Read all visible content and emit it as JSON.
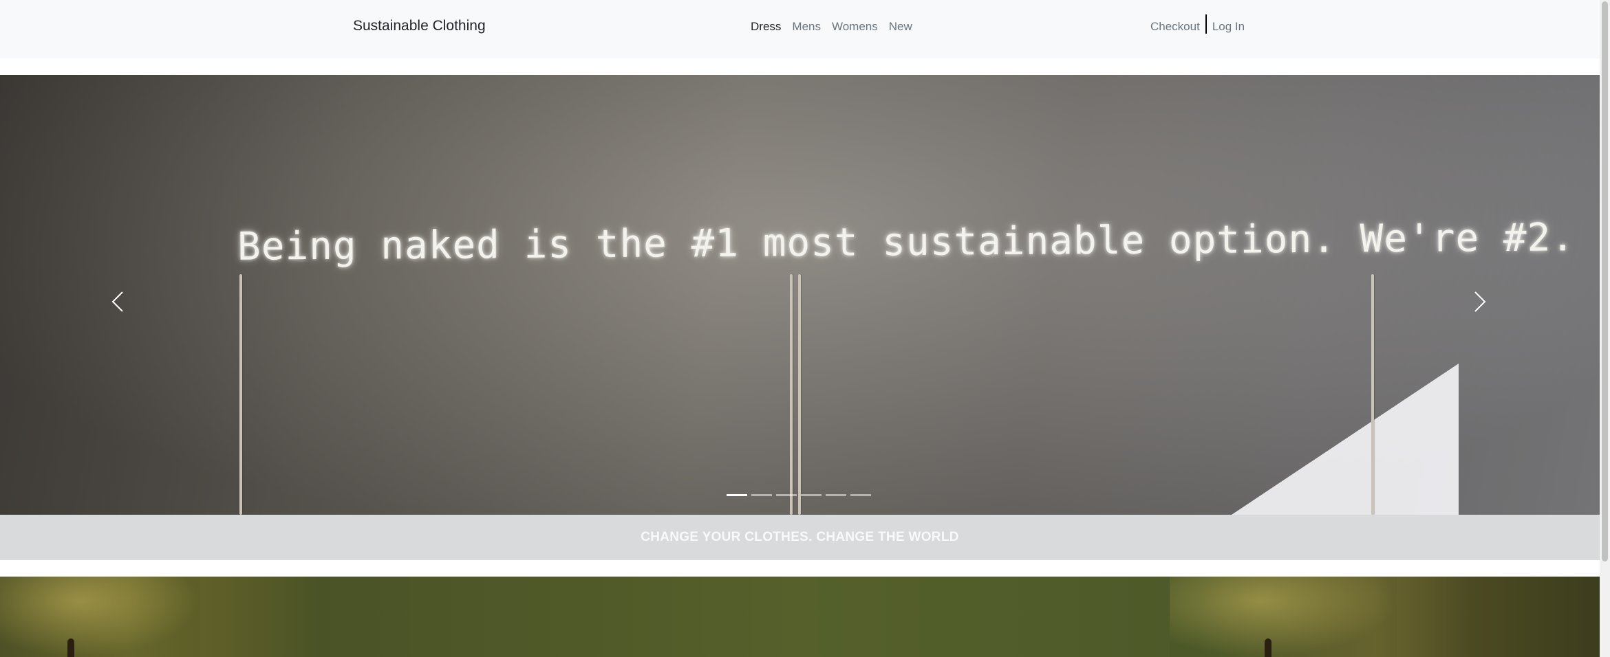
{
  "navbar": {
    "brand": "Sustainable Clothing",
    "links": [
      "Dress",
      "Mens",
      "Womens",
      "New"
    ],
    "active_link": "Dress",
    "right_links": [
      "Checkout",
      "Log In"
    ]
  },
  "carousel": {
    "slide_text": "Being naked is the #1 most sustainable option. We're #2.",
    "indicator_count": 6,
    "active_index": 0,
    "prev_icon": "chevron-left-icon",
    "next_icon": "chevron-right-icon"
  },
  "band": {
    "caption": "CHANGE YOUR CLOTHES. CHANGE THE WORLD"
  },
  "colors": {
    "navbar_bg": "#f8f9fa",
    "band_bg": "#d9dadb",
    "band_text": "#f8f9fa"
  }
}
